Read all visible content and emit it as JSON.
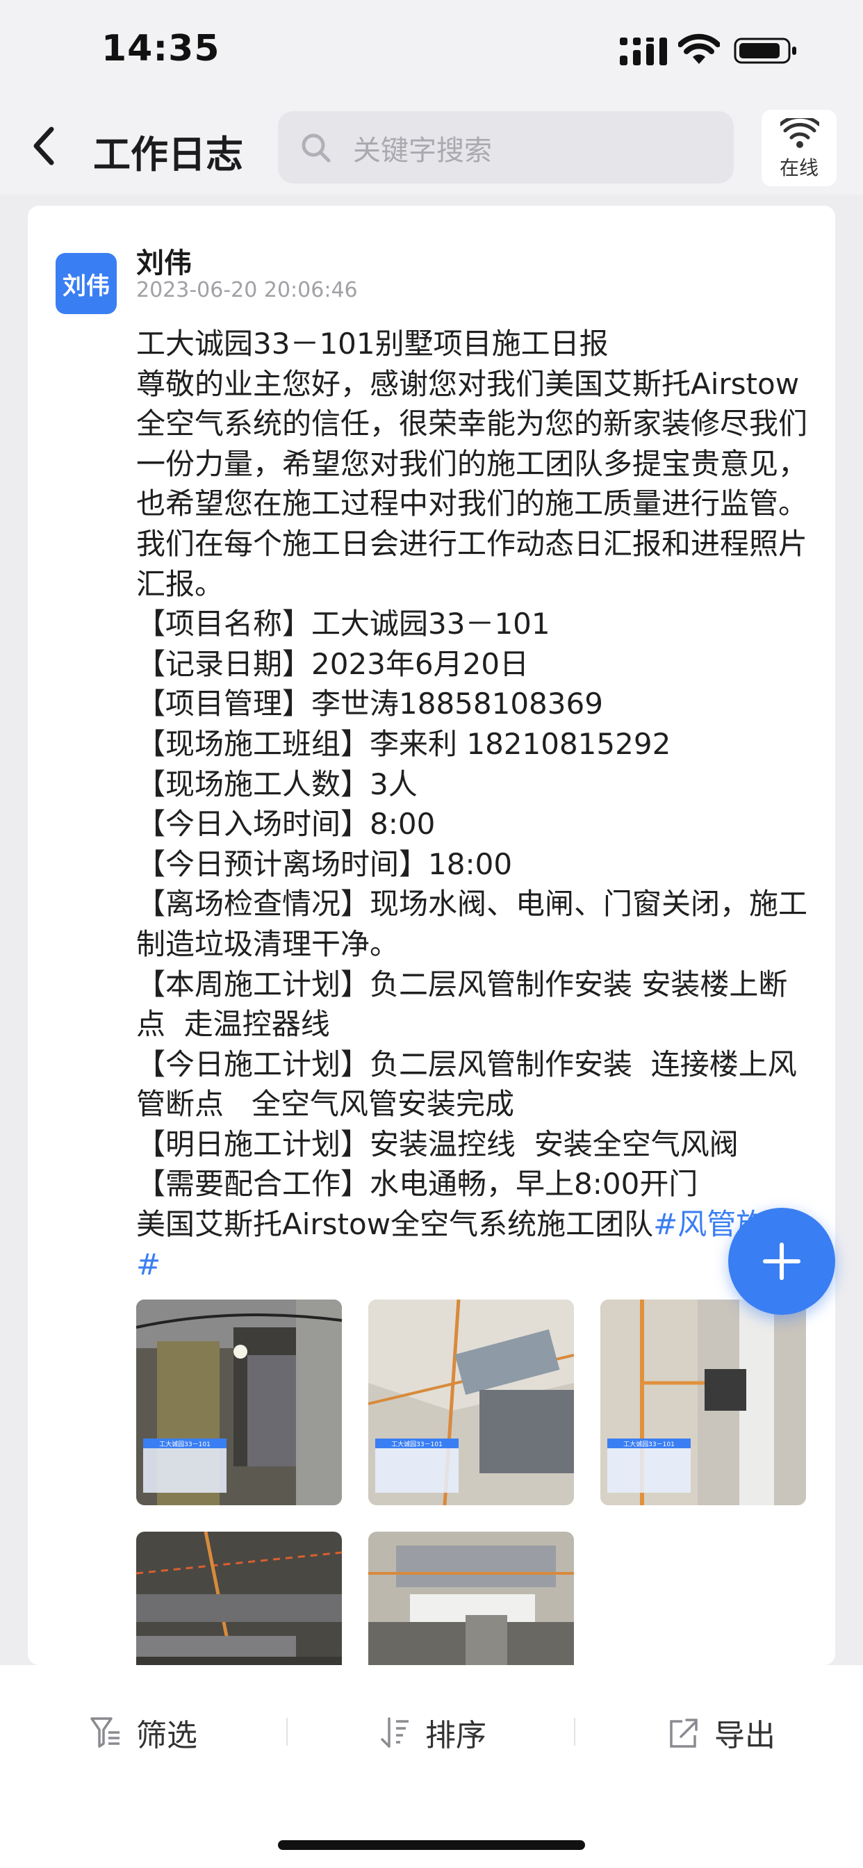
{
  "status_bar": {
    "time": "14:35"
  },
  "nav": {
    "title": "工作日志",
    "search_placeholder": "关键字搜索",
    "online_label": "在线"
  },
  "post": {
    "avatar_text": "刘伟",
    "author": "刘伟",
    "datetime": "2023-06-20  20:06:46",
    "body": "工大诚园33－101别墅项目施工日报\n尊敬的业主您好，感谢您对我们美国艾斯托Airstow全空气系统的信任，很荣幸能为您的新家装修尽我们一份力量，希望您对我们的施工团队多提宝贵意见，也希望您在施工过程中对我们的施工质量进行监管。我们在每个施工日会进行工作动态日汇报和进程照片汇报。\n【项目名称】工大诚园33－101\n【记录日期】2023年6月20日\n【项目管理】李世涛18858108369\n【现场施工班组】李来利 18210815292\n【现场施工人数】3人\n【今日入场时间】8:00\n【今日预计离场时间】18:00\n【离场检查情况】现场水阀、电闸、门窗关闭，施工制造垃圾清理干净。\n【本周施工计划】负二层风管制作安装 安装楼上断点  走温控器线\n【今日施工计划】负二层风管制作安装  连接楼上风管断点   全空气风管安装完成\n【明日施工计划】安装温控线  安装全空气风阀\n【需要配合工作】水电通畅，早上8:00开门\n美国艾斯托Airstow全空气系统施工团队",
    "tag": "#风管施工#",
    "photos": [
      {
        "title": "工大诚园33－101"
      },
      {
        "title": "工大诚园33－101"
      },
      {
        "title": "工大诚园33－101"
      },
      {
        "title": ""
      },
      {
        "title": ""
      }
    ]
  },
  "bottom_bar": {
    "filter_label": "筛选",
    "sort_label": "排序",
    "export_label": "导出"
  },
  "colors": {
    "accent": "#3a7ef3",
    "background": "#ededf0"
  }
}
